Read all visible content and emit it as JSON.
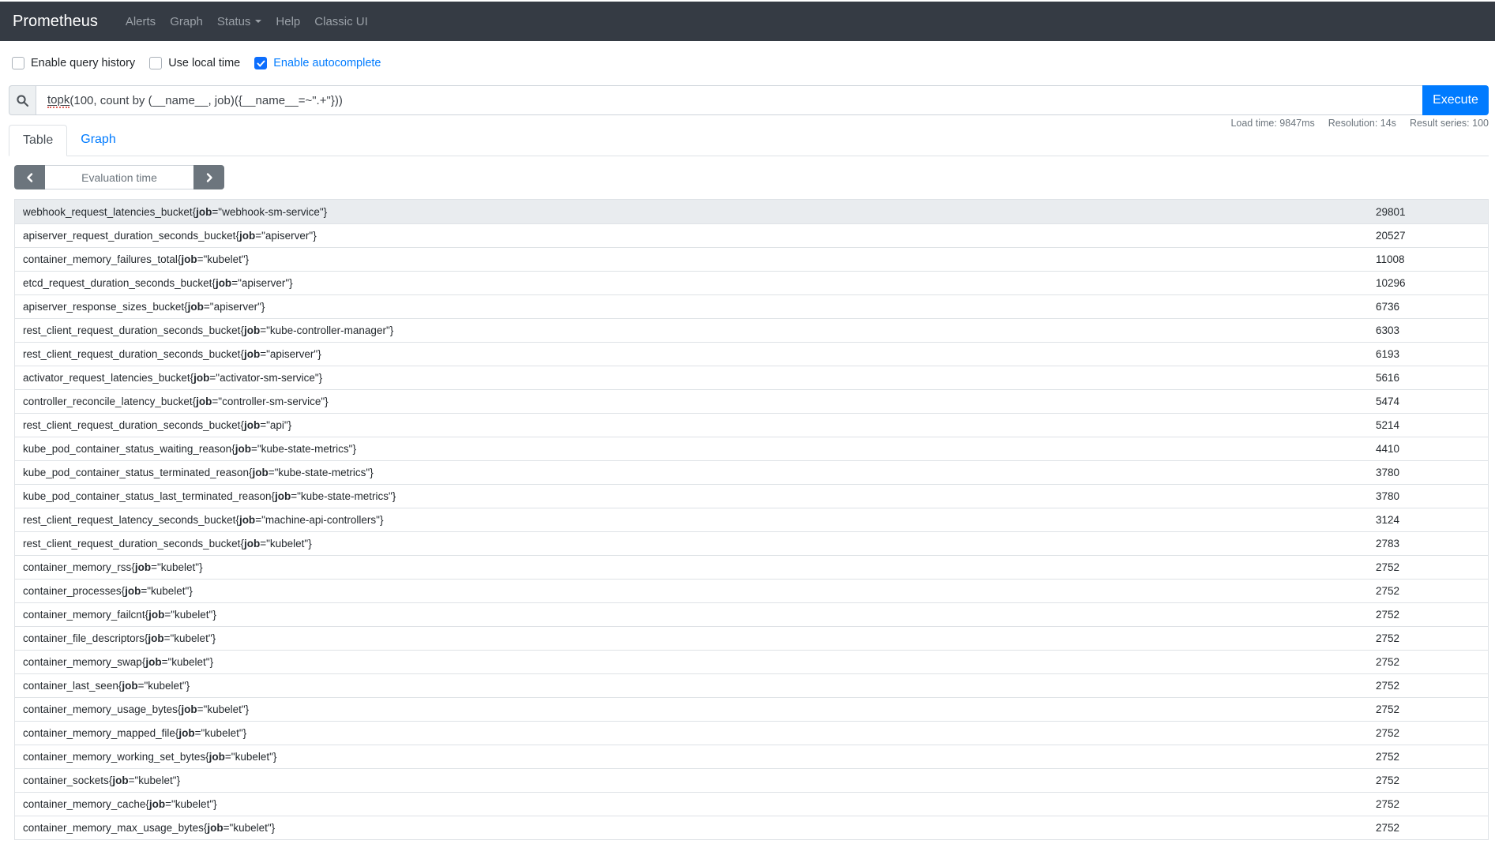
{
  "navbar": {
    "brand": "Prometheus",
    "items": [
      {
        "label": "Alerts"
      },
      {
        "label": "Graph"
      },
      {
        "label": "Status",
        "caret": true
      },
      {
        "label": "Help"
      },
      {
        "label": "Classic UI"
      }
    ]
  },
  "options": {
    "query_history": {
      "label": "Enable query history",
      "checked": false
    },
    "local_time": {
      "label": "Use local time",
      "checked": false
    },
    "autocomplete": {
      "label": "Enable autocomplete",
      "checked": true
    }
  },
  "query": {
    "icon": "search-icon",
    "misspelled_token": "topk",
    "rest": "(100, count by (__name__, job)({__name__=~\".+\"}))",
    "execute_label": "Execute"
  },
  "stats": {
    "load_time": "Load time: 9847ms",
    "resolution": "Resolution: 14s",
    "result_series": "Result series: 100"
  },
  "tabs": {
    "table": "Table",
    "graph": "Graph"
  },
  "stepper": {
    "placeholder": "Evaluation time",
    "prev_icon": "chevron-left-icon",
    "next_icon": "chevron-right-icon"
  },
  "table": {
    "rows": [
      {
        "metric": "webhook_request_latencies_bucket",
        "job": "webhook-sm-service",
        "value": "29801",
        "highlight": true
      },
      {
        "metric": "apiserver_request_duration_seconds_bucket",
        "job": "apiserver",
        "value": "20527"
      },
      {
        "metric": "container_memory_failures_total",
        "job": "kubelet",
        "value": "11008"
      },
      {
        "metric": "etcd_request_duration_seconds_bucket",
        "job": "apiserver",
        "value": "10296"
      },
      {
        "metric": "apiserver_response_sizes_bucket",
        "job": "apiserver",
        "value": "6736"
      },
      {
        "metric": "rest_client_request_duration_seconds_bucket",
        "job": "kube-controller-manager",
        "value": "6303"
      },
      {
        "metric": "rest_client_request_duration_seconds_bucket",
        "job": "apiserver",
        "value": "6193"
      },
      {
        "metric": "activator_request_latencies_bucket",
        "job": "activator-sm-service",
        "value": "5616"
      },
      {
        "metric": "controller_reconcile_latency_bucket",
        "job": "controller-sm-service",
        "value": "5474"
      },
      {
        "metric": "rest_client_request_duration_seconds_bucket",
        "job": "api",
        "value": "5214"
      },
      {
        "metric": "kube_pod_container_status_waiting_reason",
        "job": "kube-state-metrics",
        "value": "4410"
      },
      {
        "metric": "kube_pod_container_status_terminated_reason",
        "job": "kube-state-metrics",
        "value": "3780"
      },
      {
        "metric": "kube_pod_container_status_last_terminated_reason",
        "job": "kube-state-metrics",
        "value": "3780"
      },
      {
        "metric": "rest_client_request_latency_seconds_bucket",
        "job": "machine-api-controllers",
        "value": "3124"
      },
      {
        "metric": "rest_client_request_duration_seconds_bucket",
        "job": "kubelet",
        "value": "2783"
      },
      {
        "metric": "container_memory_rss",
        "job": "kubelet",
        "value": "2752"
      },
      {
        "metric": "container_processes",
        "job": "kubelet",
        "value": "2752"
      },
      {
        "metric": "container_memory_failcnt",
        "job": "kubelet",
        "value": "2752"
      },
      {
        "metric": "container_file_descriptors",
        "job": "kubelet",
        "value": "2752"
      },
      {
        "metric": "container_memory_swap",
        "job": "kubelet",
        "value": "2752"
      },
      {
        "metric": "container_last_seen",
        "job": "kubelet",
        "value": "2752"
      },
      {
        "metric": "container_memory_usage_bytes",
        "job": "kubelet",
        "value": "2752"
      },
      {
        "metric": "container_memory_mapped_file",
        "job": "kubelet",
        "value": "2752"
      },
      {
        "metric": "container_memory_working_set_bytes",
        "job": "kubelet",
        "value": "2752"
      },
      {
        "metric": "container_sockets",
        "job": "kubelet",
        "value": "2752"
      },
      {
        "metric": "container_memory_cache",
        "job": "kubelet",
        "value": "2752"
      },
      {
        "metric": "container_memory_max_usage_bytes",
        "job": "kubelet",
        "value": "2752"
      }
    ]
  },
  "colors": {
    "accent_blue": "#007bff",
    "navbar_bg": "#353b44",
    "highlight_row_bg": "#e9ecef",
    "border_gray": "#dee2e6",
    "muted_text": "#6c757d"
  }
}
